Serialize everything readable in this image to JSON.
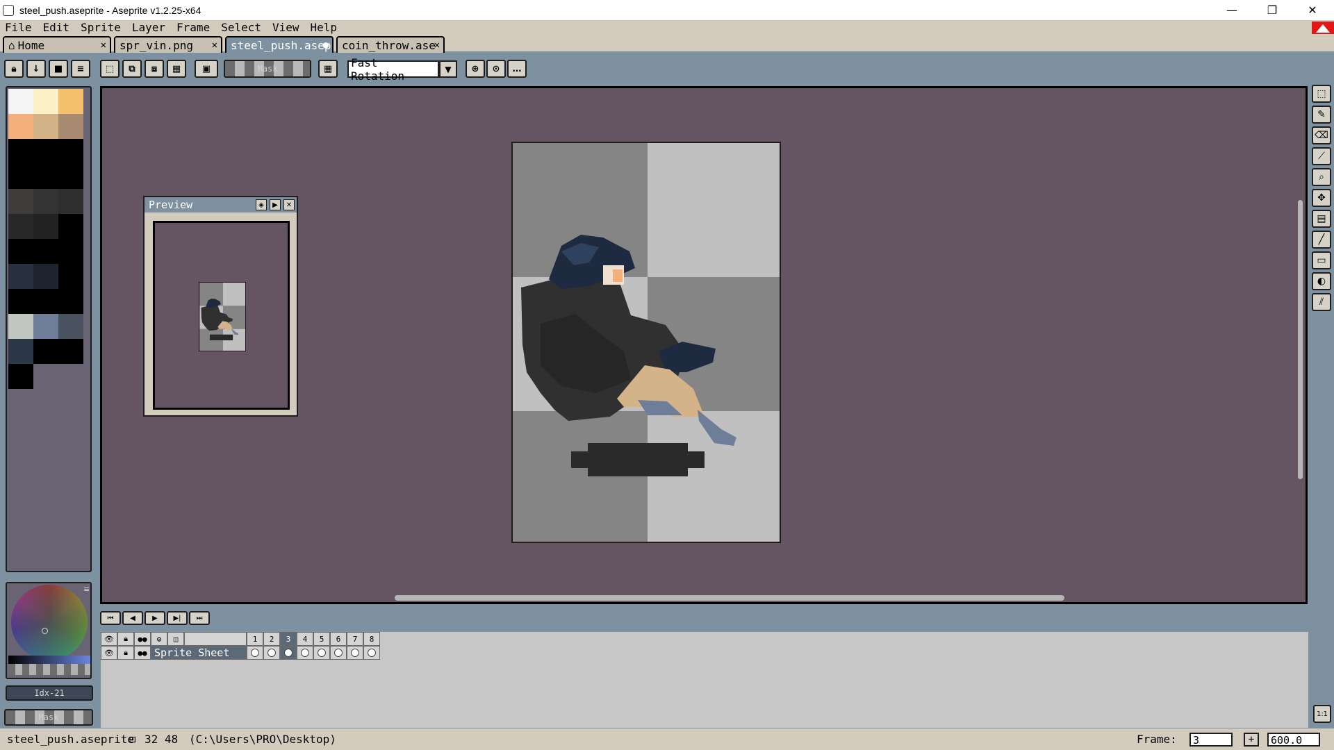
{
  "window": {
    "title": "steel_push.aseprite - Aseprite v1.2.25-x64",
    "minimize": "—",
    "restore": "❐",
    "close": "✕"
  },
  "menu": [
    "File",
    "Edit",
    "Sprite",
    "Layer",
    "Frame",
    "Select",
    "View",
    "Help"
  ],
  "tabs": [
    {
      "label": "Home",
      "icon": "home-icon",
      "close": "✕"
    },
    {
      "label": "spr_vin.png",
      "close": "✕"
    },
    {
      "label": "steel_push.asep",
      "close": "●",
      "active": true
    },
    {
      "label": "coin_throw.ase",
      "close": "✕"
    }
  ],
  "toolbar": {
    "mask_label": "Mask",
    "rotation_value": "Fast Rotation"
  },
  "palette": {
    "colors": [
      "#f5f5f5",
      "#faf1c6",
      "#f5c06e",
      "#f3b07d",
      "#d4b389",
      "#a88b70",
      "#000000",
      "#000000",
      "#000000",
      "#000000",
      "#000000",
      "#000000",
      "#403c3c",
      "#333333",
      "#2e2e2e",
      "#282828",
      "#222222",
      "#000000",
      "#000000",
      "#000000",
      "#000000",
      "#283040",
      "#1e2430",
      "#000000",
      "#000000",
      "#000000",
      "#000000",
      "#c1c6c0",
      "#6e7e98",
      "#4a5260",
      "#2c3848",
      "#000000",
      "#000000",
      "#000000"
    ]
  },
  "color_index": "Idx-21",
  "mask2_label": "Mask",
  "preview": {
    "title": "Preview"
  },
  "timeline": {
    "frames": [
      "1",
      "2",
      "3",
      "4",
      "5",
      "6",
      "7",
      "8"
    ],
    "current_frame_index": 2,
    "layer_name": "Sprite Sheet"
  },
  "status": {
    "filename": "steel_push.aseprite",
    "size": "32 48",
    "path": "(C:\\Users\\PRO\\Desktop)",
    "frame_label": "Frame:",
    "frame_value": "3",
    "zoom_value": "600.0"
  }
}
